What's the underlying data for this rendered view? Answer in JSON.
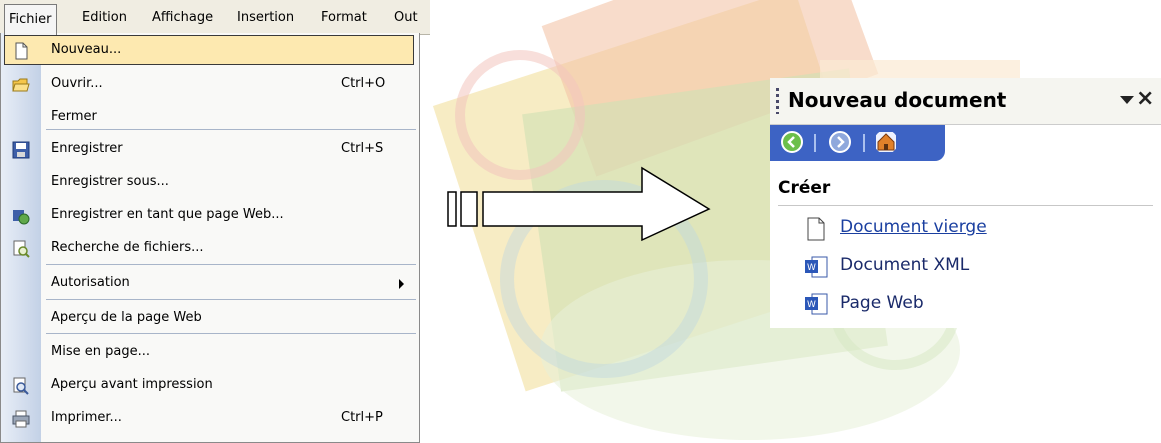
{
  "menubar": {
    "items": [
      "Fichier",
      "Edition",
      "Affichage",
      "Insertion",
      "Format",
      "Out"
    ]
  },
  "menu": {
    "items": [
      {
        "label": "Nouveau...",
        "shortcut": "",
        "icon": "new-doc-icon",
        "highlighted": true
      },
      {
        "label": "Ouvrir...",
        "shortcut": "Ctrl+O",
        "icon": "folder-open-icon"
      },
      {
        "label": "Fermer",
        "shortcut": ""
      },
      {
        "label": "Enregistrer",
        "shortcut": "Ctrl+S",
        "icon": "save-disk-icon"
      },
      {
        "label": "Enregistrer sous...",
        "shortcut": ""
      },
      {
        "label": "Enregistrer en tant que page Web...",
        "shortcut": "",
        "icon": "web-save-icon"
      },
      {
        "label": "Recherche de fichiers...",
        "shortcut": "",
        "icon": "file-search-icon"
      },
      {
        "label": "Autorisation",
        "shortcut": "",
        "submenu": true
      },
      {
        "label": "Aperçu de la page Web",
        "shortcut": ""
      },
      {
        "label": "Mise en page...",
        "shortcut": ""
      },
      {
        "label": "Aperçu avant impression",
        "shortcut": "",
        "icon": "print-preview-icon"
      },
      {
        "label": "Imprimer...",
        "shortcut": "Ctrl+P",
        "icon": "printer-icon"
      }
    ]
  },
  "taskpane": {
    "title": "Nouveau document",
    "section": "Créer",
    "links": [
      {
        "label": "Document vierge",
        "icon": "blank-document-icon"
      },
      {
        "label": "Document XML",
        "icon": "word-document-icon"
      },
      {
        "label": "Page Web",
        "icon": "word-document-icon"
      }
    ],
    "nav_icons": [
      "back-icon",
      "forward-icon",
      "home-icon"
    ]
  },
  "colors": {
    "highlight": "#fde9b0",
    "nav_bar": "#3d63c4",
    "link": "#1a3fa0"
  }
}
